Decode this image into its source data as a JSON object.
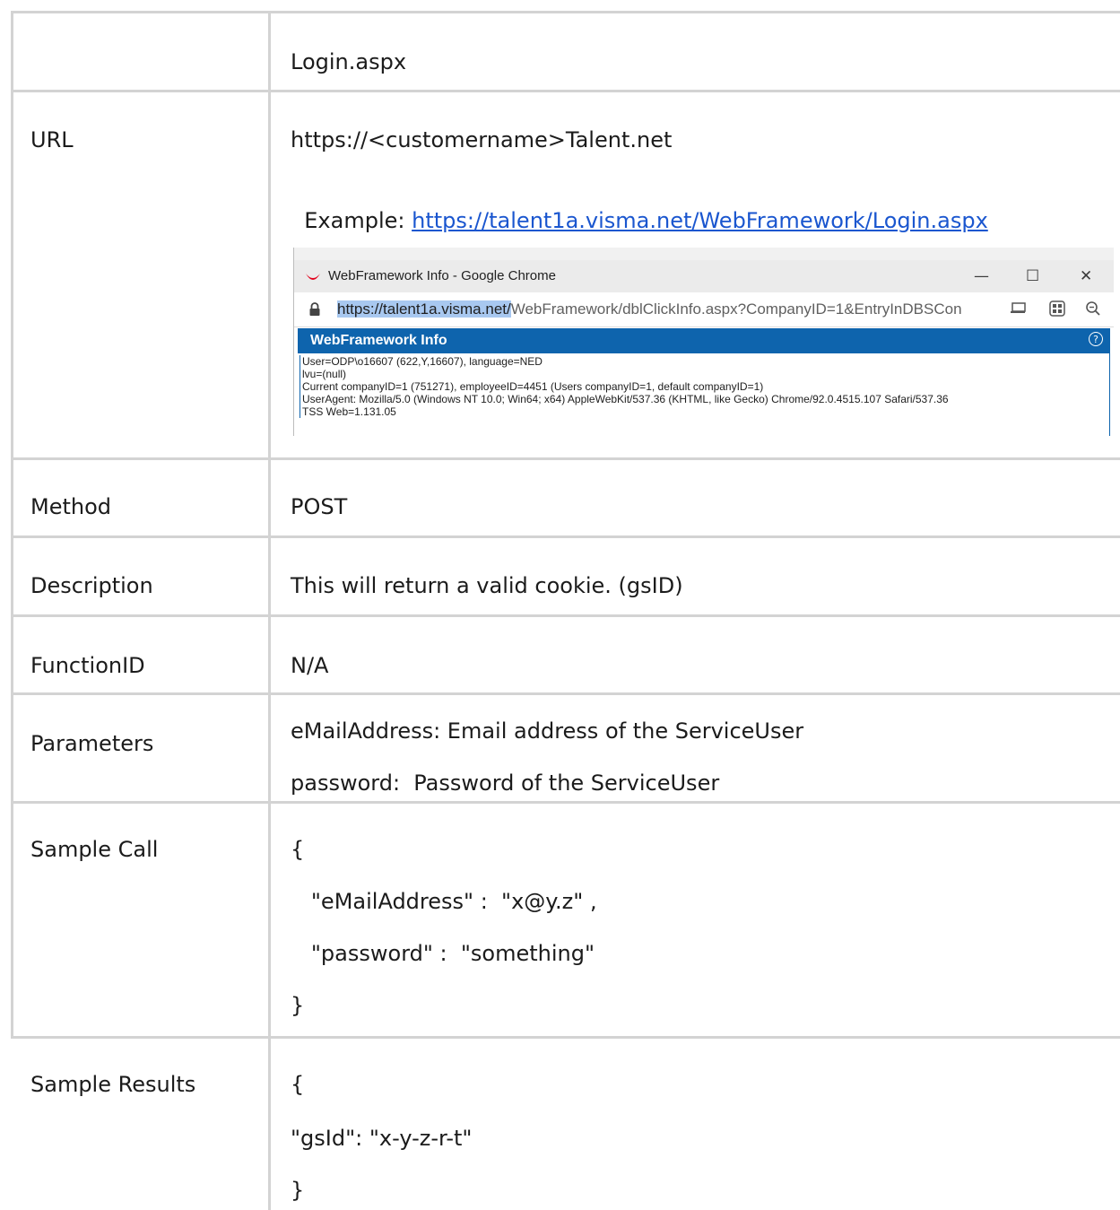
{
  "table": {
    "header_value": "Login.aspx",
    "url": {
      "label": "URL",
      "pattern": "https://<customername>Talent.net",
      "example_prefix": "Example: ",
      "example_link": "https://talent1a.visma.net/WebFramework/Login.aspx"
    },
    "method": {
      "label": "Method",
      "value": "POST"
    },
    "description": {
      "label": "Description",
      "value": "This will return a valid cookie. (gsID)"
    },
    "function_id": {
      "label": "FunctionID",
      "value": "N/A"
    },
    "parameters": {
      "label": "Parameters",
      "lines": [
        "eMailAddress: Email address of the ServiceUser",
        "password:  Password of the ServiceUser"
      ]
    },
    "sample_call": {
      "label": "Sample Call",
      "lines": [
        "{",
        "   \"eMailAddress\" :  \"x@y.z\" ,",
        "   \"password\" :  \"something\"",
        "}"
      ]
    },
    "sample_results": {
      "label": "Sample Results",
      "lines": [
        "{",
        "\"gsId\": \"x-y-z-r-t\"",
        "}"
      ]
    }
  },
  "screenshot": {
    "window_title": "WebFramework Info - Google Chrome",
    "minimize": "—",
    "maximize": "☐",
    "close": "✕",
    "url_highlight": "https://talent1a.visma.net/",
    "url_rest": "WebFramework/dblClickInfo.aspx?CompanyID=1&EntryInDBSCon",
    "panel_title": "WebFramework Info",
    "help_icon": "?",
    "info_lines": [
      "User=ODP\\o16607 (622,Y,16607), language=NED",
      "lvu=(null)",
      "Current companyID=1 (751271), employeeID=4451 (Users companyID=1, default companyID=1)",
      "UserAgent: Mozilla/5.0 (Windows NT 10.0; Win64; x64) AppleWebKit/537.36 (KHTML, like Gecko) Chrome/92.0.4515.107 Safari/537.36",
      "TSS Web=1.131.05"
    ]
  }
}
